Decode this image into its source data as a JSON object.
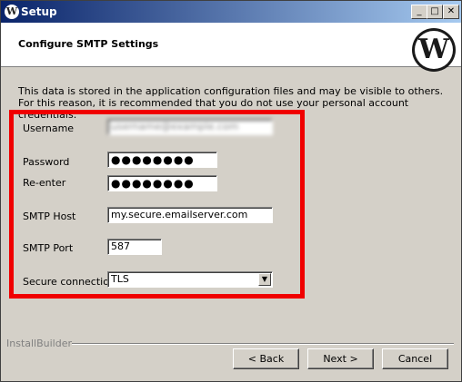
{
  "window": {
    "title": "Setup"
  },
  "header": {
    "title": "Configure SMTP Settings"
  },
  "description": "This data is stored in the application configuration files and may be visible to others. For this reason, it is recommended that you do not use your personal account credentials.",
  "form": {
    "username": {
      "label": "Username",
      "value": "username@example.com"
    },
    "password": {
      "label": "Password",
      "value": "●●●●●●●●"
    },
    "reenter": {
      "label": "Re-enter",
      "value": "●●●●●●●●"
    },
    "smtp_host": {
      "label": "SMTP Host",
      "value": "my.secure.emailserver.com"
    },
    "smtp_port": {
      "label": "SMTP Port",
      "value": "587"
    },
    "secure_connection": {
      "label": "Secure connection",
      "value": "TLS"
    }
  },
  "footer": {
    "brand": "InstallBuilder",
    "back_label": "< Back",
    "next_label": "Next >",
    "cancel_label": "Cancel"
  },
  "icons": {
    "title_icon": "wordpress-logo-icon",
    "header_logo": "wordpress-logo-icon"
  },
  "colors": {
    "highlight": "#f00000",
    "titlebar_start": "#0a246a",
    "titlebar_end": "#a6caf0"
  }
}
